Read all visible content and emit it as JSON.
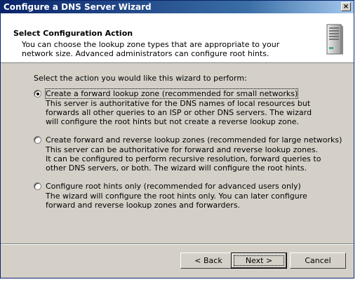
{
  "window": {
    "title": "Configure a DNS Server Wizard",
    "close_glyph": "×"
  },
  "header": {
    "title": "Select Configuration Action",
    "description": "You can choose the lookup zone types that are appropriate to your network size. Advanced administrators can configure root hints.",
    "icon": "server-icon"
  },
  "main": {
    "prompt": "Select the action you would like this wizard to perform:",
    "options": [
      {
        "label": "Create a forward lookup zone (recommended for small networks)",
        "description": "This server is authoritative for the DNS names of local resources but forwards all other queries to an ISP or other DNS servers. The wizard will configure the root hints but not create a reverse lookup zone.",
        "selected": true
      },
      {
        "label": "Create forward and reverse lookup zones (recommended for large networks)",
        "description": "This server can be authoritative for forward and reverse lookup zones. It can be configured to perform recursive resolution, forward queries to other DNS servers, or both. The wizard will configure the root hints.",
        "selected": false
      },
      {
        "label": "Configure root hints only (recommended for advanced users only)",
        "description": "The wizard will configure the root hints only. You can later configure forward and reverse lookup zones and forwarders.",
        "selected": false
      }
    ]
  },
  "footer": {
    "back_label": "< Back",
    "next_label": "Next >",
    "cancel_label": "Cancel"
  },
  "colors": {
    "titlebar": "#0a246a",
    "dialog_bg": "#d4d0c8",
    "header_bg": "#ffffff"
  }
}
